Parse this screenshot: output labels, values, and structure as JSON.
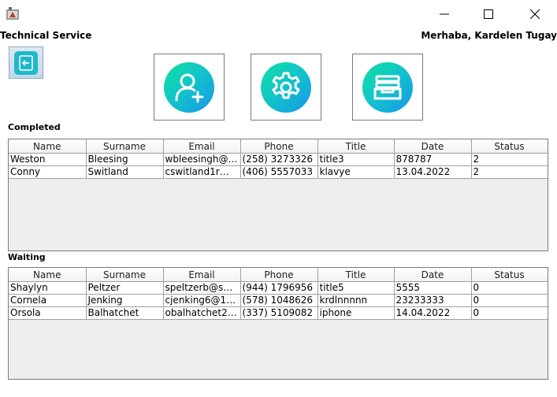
{
  "window": {
    "app_icon": "app-logo-icon",
    "controls": [
      "minimize-icon",
      "maximize-icon",
      "close-icon"
    ]
  },
  "header": {
    "title": "Technical Service",
    "greeting": "Merhaba, Kardelen Tugay"
  },
  "toolbar": {
    "back_icon": "logout-icon",
    "actions": [
      {
        "icon": "add-user-icon"
      },
      {
        "icon": "settings-gear-icon"
      },
      {
        "icon": "archive-tray-icon"
      }
    ]
  },
  "completed": {
    "label": "Completed",
    "columns": [
      "Name",
      "Surname",
      "Email",
      "Phone",
      "Title",
      "Date",
      "Status"
    ],
    "rows": [
      [
        "Weston",
        "Bleesing",
        "wbleesingh@fl...",
        "(258) 3273326",
        "title3",
        "878787",
        "2"
      ],
      [
        "Conny",
        "Switland",
        "cswitland1r@pr...",
        "(406) 5557033",
        "klavye",
        "13.04.2022",
        "2"
      ]
    ]
  },
  "waiting": {
    "label": "Waiting",
    "columns": [
      "Name",
      "Surname",
      "Email",
      "Phone",
      "Title",
      "Date",
      "Status"
    ],
    "rows": [
      [
        "Shaylyn",
        "Peltzer",
        "speltzerb@seat...",
        "(944) 1796956",
        "title5",
        "5555",
        "0"
      ],
      [
        "Cornela",
        "Jenking",
        "cjenking6@163....",
        "(578) 1048626",
        "krdlnnnnn",
        "23233333",
        "0"
      ],
      [
        "Orsola",
        "Balhatchet",
        "obalhatchet2p....",
        "(337) 5109082",
        "iphone",
        "14.04.2022",
        "0"
      ]
    ]
  },
  "colors": {
    "accent_start": "#0fe0a0",
    "accent_end": "#1896e8",
    "grid_line": "#a0a0a0",
    "empty_area": "#eeeeee"
  }
}
